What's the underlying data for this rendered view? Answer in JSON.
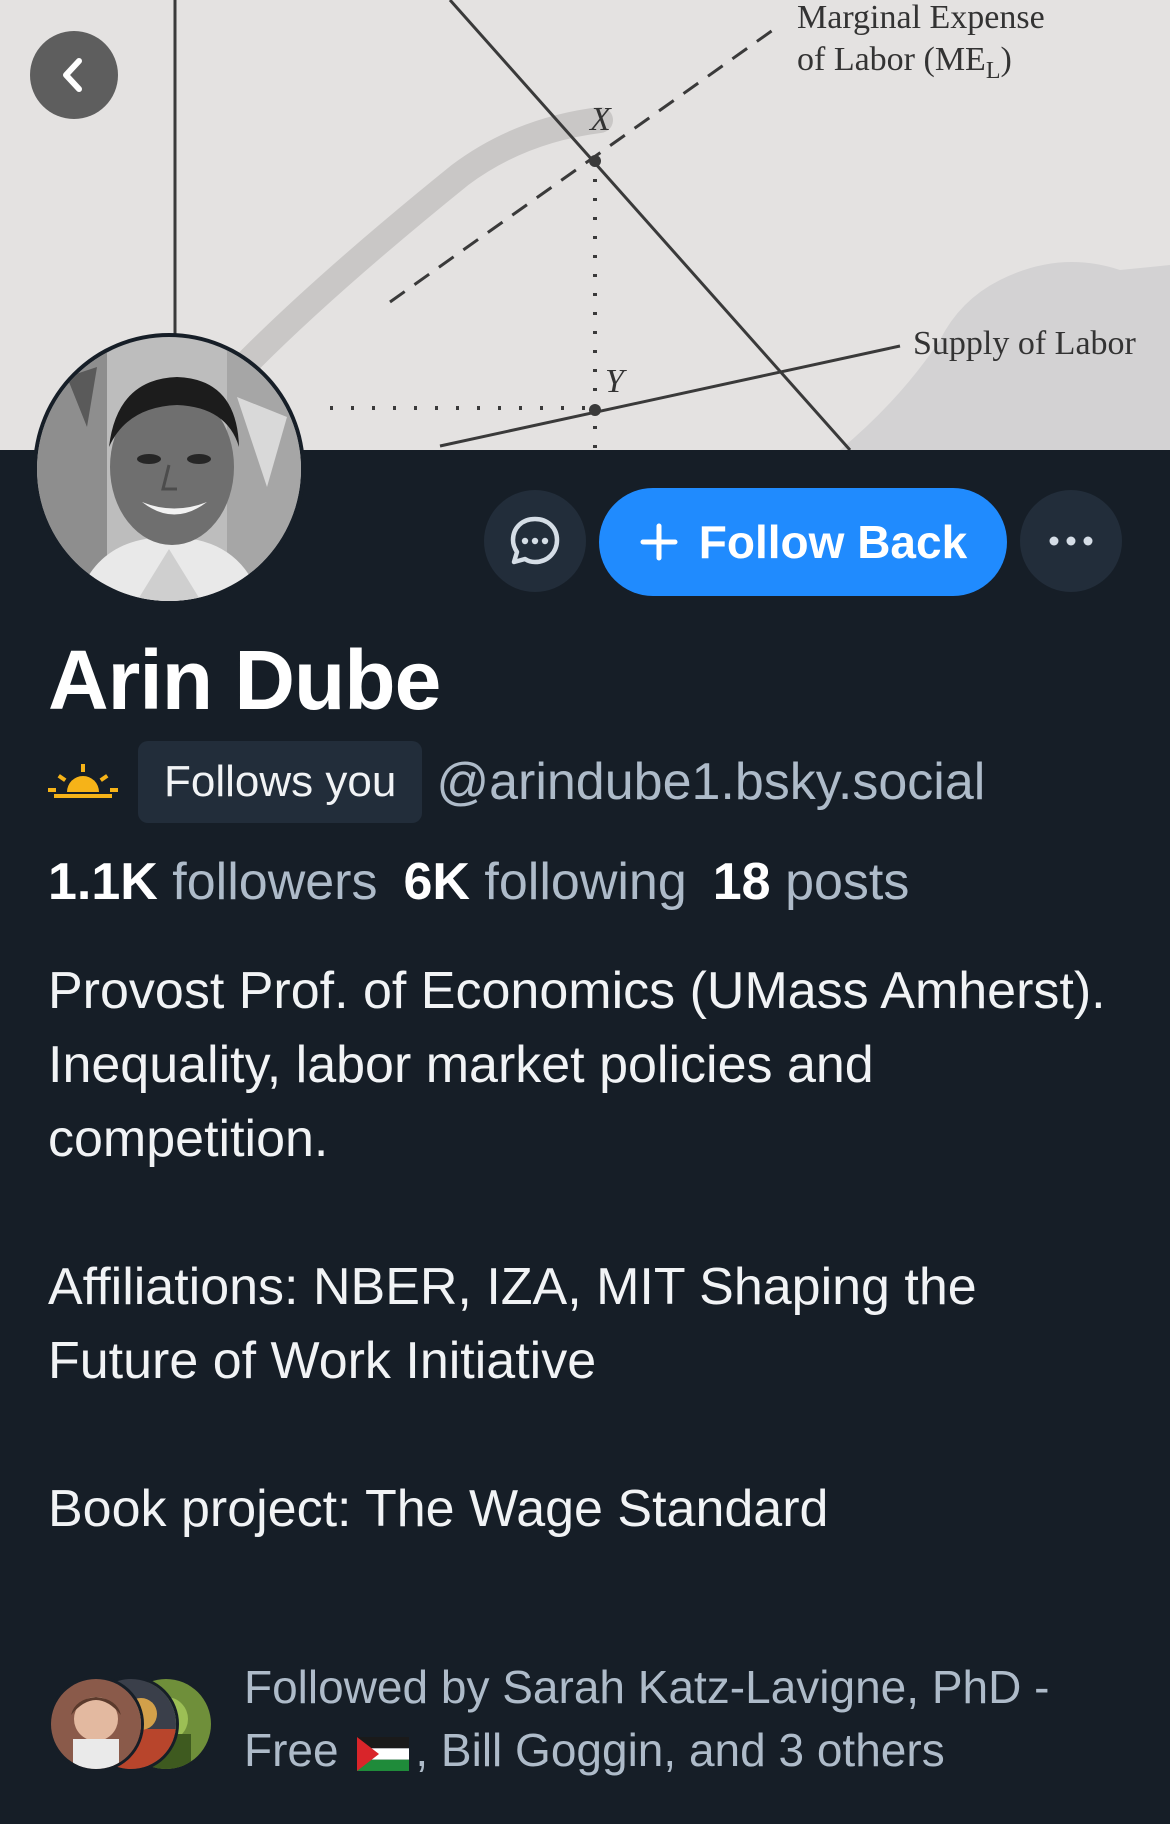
{
  "banner": {
    "chart_labels": {
      "marginal_expense_line1": "Marginal Expense",
      "marginal_expense_line2": "of Labor (ME",
      "marginal_expense_sub": "L",
      "marginal_expense_close": ")",
      "point_x": "X",
      "point_y": "Y",
      "supply_label": "Supply of Labor"
    }
  },
  "header": {
    "back_icon": "chevron-left-icon"
  },
  "actions": {
    "message_icon": "chat-bubble-icon",
    "follow_label": "Follow Back",
    "more_icon": "ellipsis-icon"
  },
  "profile": {
    "display_name": "Arin Dube",
    "follows_you": "Follows you",
    "handle": "@arindube1.bsky.social",
    "stats": {
      "followers_num": "1.1K",
      "followers_label": "followers",
      "following_num": "6K",
      "following_label": "following",
      "posts_num": "18",
      "posts_label": "posts"
    },
    "bio": {
      "line1": "Provost Prof. of Economics (UMass Amherst).",
      "line2": "Inequality, labor market policies and competition.",
      "line3": "Affiliations: NBER, IZA, MIT Shaping the Future of Work Initiative",
      "line4": "Book project: The Wage Standard"
    },
    "followed_by": {
      "part1": "Followed by Sarah Katz-Lavigne, PhD - Free",
      "part2": ", Bill Goggin, and 3 others"
    }
  },
  "colors": {
    "background": "#161e27",
    "accent": "#208bfe",
    "secondary_text": "#aebbc9",
    "button_bg": "#222d3a"
  }
}
